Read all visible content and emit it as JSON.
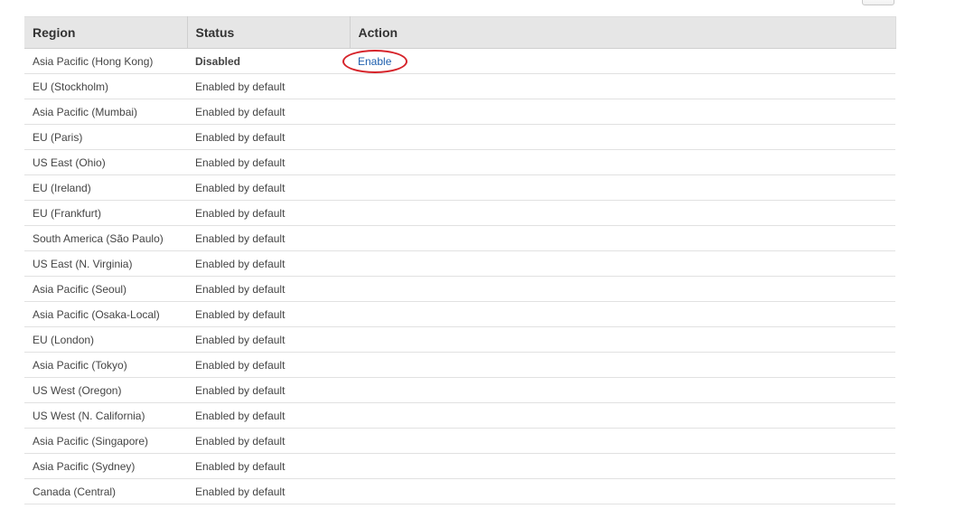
{
  "table": {
    "headers": {
      "region": "Region",
      "status": "Status",
      "action": "Action"
    },
    "rows": [
      {
        "region": "Asia Pacific (Hong Kong)",
        "status": "Disabled",
        "action": "Enable"
      },
      {
        "region": "EU (Stockholm)",
        "status": "Enabled by default",
        "action": ""
      },
      {
        "region": "Asia Pacific (Mumbai)",
        "status": "Enabled by default",
        "action": ""
      },
      {
        "region": "EU (Paris)",
        "status": "Enabled by default",
        "action": ""
      },
      {
        "region": "US East (Ohio)",
        "status": "Enabled by default",
        "action": ""
      },
      {
        "region": "EU (Ireland)",
        "status": "Enabled by default",
        "action": ""
      },
      {
        "region": "EU (Frankfurt)",
        "status": "Enabled by default",
        "action": ""
      },
      {
        "region": "South America (São Paulo)",
        "status": "Enabled by default",
        "action": ""
      },
      {
        "region": "US East (N. Virginia)",
        "status": "Enabled by default",
        "action": ""
      },
      {
        "region": "Asia Pacific (Seoul)",
        "status": "Enabled by default",
        "action": ""
      },
      {
        "region": "Asia Pacific (Osaka-Local)",
        "status": "Enabled by default",
        "action": ""
      },
      {
        "region": "EU (London)",
        "status": "Enabled by default",
        "action": ""
      },
      {
        "region": "Asia Pacific (Tokyo)",
        "status": "Enabled by default",
        "action": ""
      },
      {
        "region": "US West (Oregon)",
        "status": "Enabled by default",
        "action": ""
      },
      {
        "region": "US West (N. California)",
        "status": "Enabled by default",
        "action": ""
      },
      {
        "region": "Asia Pacific (Singapore)",
        "status": "Enabled by default",
        "action": ""
      },
      {
        "region": "Asia Pacific (Sydney)",
        "status": "Enabled by default",
        "action": ""
      },
      {
        "region": "Canada (Central)",
        "status": "Enabled by default",
        "action": ""
      }
    ]
  },
  "colors": {
    "enabled_status": "#1a9b3a",
    "link": "#1f5fae",
    "highlight_ring": "#d6232a",
    "header_background": "#e6e6e6"
  }
}
